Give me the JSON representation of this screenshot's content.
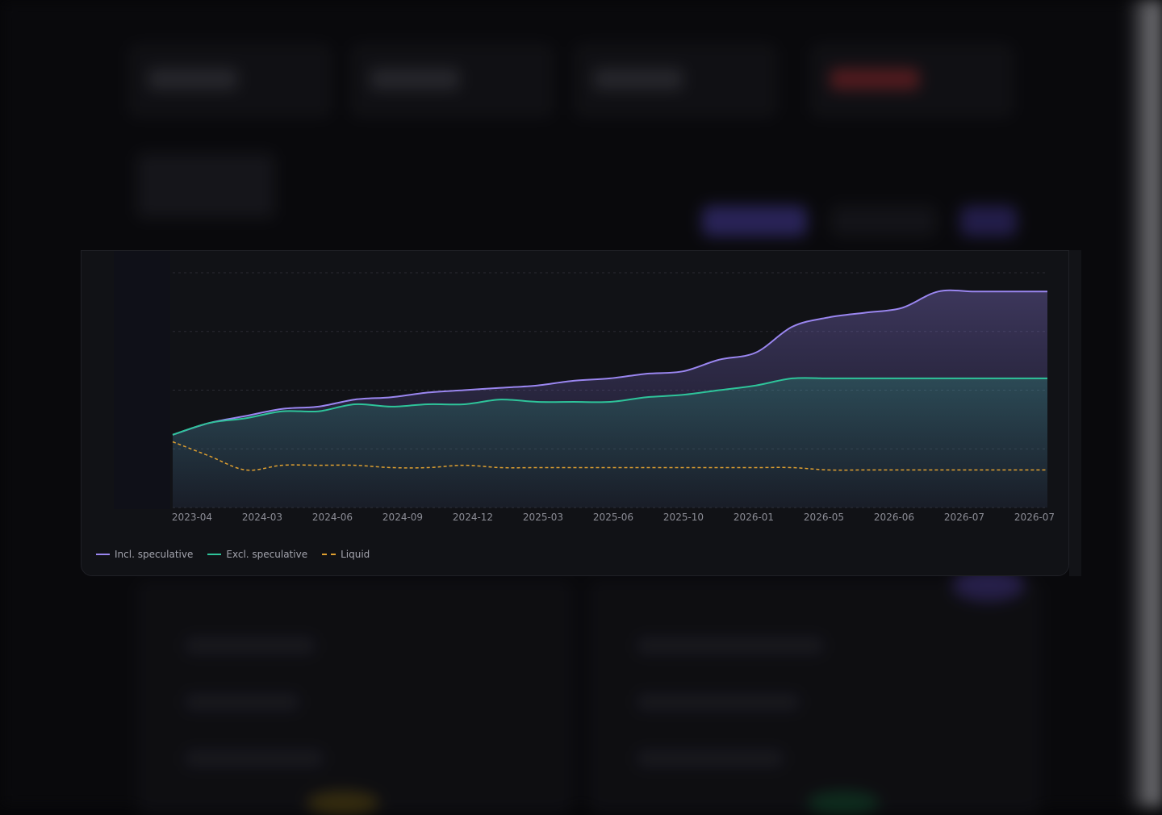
{
  "colors": {
    "incl_speculative": "#9a86f0",
    "excl_speculative": "#2ec49a",
    "liquid": "#e0a030",
    "card_bg": "#111216",
    "tick_text": "#8c8d96"
  },
  "chart_data": {
    "type": "area",
    "x_tick_labels": [
      "2023-04",
      "2024-03",
      "2024-06",
      "2024-09",
      "2024-12",
      "2025-03",
      "2025-06",
      "2025-10",
      "2026-01",
      "2026-05",
      "2026-06",
      "2026-07",
      "2026-07"
    ],
    "x": [
      0,
      0.5,
      1,
      1.5,
      2,
      2.5,
      3,
      3.5,
      4,
      4.5,
      5,
      5.5,
      6,
      6.5,
      7,
      7.5,
      8,
      8.5,
      9,
      9.5,
      10,
      10.5,
      11,
      11.5,
      12
    ],
    "ylim": [
      0,
      100
    ],
    "grid": true,
    "y_ticks_visible": false,
    "legend_position": "bottom-left",
    "series": [
      {
        "name": "Incl. speculative",
        "values": [
          31,
          36,
          39,
          42,
          43,
          46,
          47,
          49,
          50,
          51,
          52,
          54,
          55,
          57,
          58,
          63,
          66,
          77,
          81,
          83,
          85,
          92,
          92,
          92,
          92
        ],
        "style": "solid",
        "fill": true
      },
      {
        "name": "Excl. speculative",
        "values": [
          31,
          36,
          38,
          41,
          41,
          44,
          43,
          44,
          44,
          46,
          45,
          45,
          45,
          47,
          48,
          50,
          52,
          55,
          55,
          55,
          55,
          55,
          55,
          55,
          55
        ],
        "style": "solid",
        "fill": true
      },
      {
        "name": "Liquid",
        "values": [
          28,
          22,
          16,
          18,
          18,
          18,
          17,
          17,
          18,
          17,
          17,
          17,
          17,
          17,
          17,
          17,
          17,
          17,
          16,
          16,
          16,
          16,
          16,
          16,
          16
        ],
        "style": "dashed",
        "fill": false
      }
    ]
  }
}
